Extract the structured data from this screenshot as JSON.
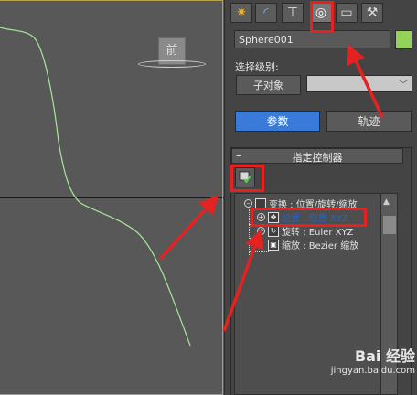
{
  "viewport": {
    "viewcube_label": "前"
  },
  "command_panel": {
    "tabs": [
      {
        "icon": "create-icon",
        "glyph": "✷"
      },
      {
        "icon": "modify-icon",
        "glyph": "◜"
      },
      {
        "icon": "hierarchy-icon",
        "glyph": "⊤"
      },
      {
        "icon": "motion-icon",
        "glyph": "◎"
      },
      {
        "icon": "display-icon",
        "glyph": "▭"
      },
      {
        "icon": "utilities-icon",
        "glyph": "⚒"
      }
    ],
    "object_name": "Sphere001",
    "object_color": "#93d35b",
    "selection_level_label": "选择级别:",
    "subobject_button": "子对象",
    "subobject_value": "",
    "parameters_button": "参数",
    "trajectories_button": "轨迹",
    "rollout_toggle": "–",
    "rollout_title": "指定控制器",
    "tree": {
      "items": [
        {
          "label": "变换 : 位置/旋转/缩放"
        },
        {
          "label": "位置 : 位置 XYZ"
        },
        {
          "label": "旋转 : Euler XYZ"
        },
        {
          "label": "缩放 : Bezier 缩放"
        }
      ]
    }
  },
  "watermark": {
    "logo": "Bai 经验",
    "url": "jingyan.baidu.com"
  }
}
